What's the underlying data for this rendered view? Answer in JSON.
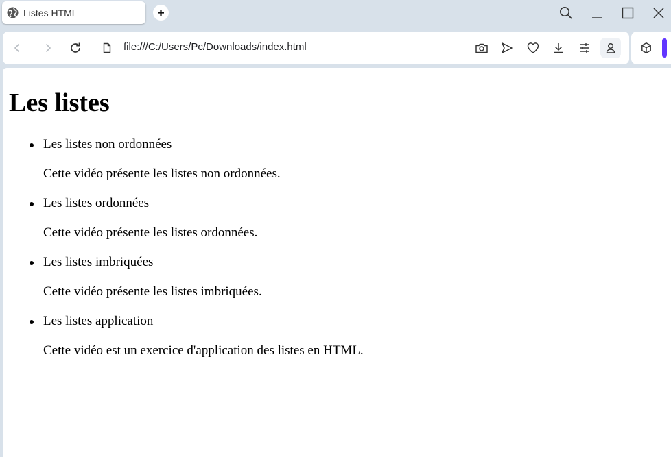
{
  "tab": {
    "title": "Listes HTML"
  },
  "address_bar": {
    "url": "file:///C:/Users/Pc/Downloads/index.html"
  },
  "colors": {
    "accent": "#6236ff",
    "chrome_bg": "#d8e1ea"
  },
  "page": {
    "heading": "Les listes",
    "items": [
      {
        "title": "Les listes non ordonnées",
        "description": "Cette vidéo présente les listes non ordonnées."
      },
      {
        "title": "Les listes ordonnées",
        "description": "Cette vidéo présente les listes ordonnées."
      },
      {
        "title": "Les listes imbriquées",
        "description": "Cette vidéo présente les listes imbriquées."
      },
      {
        "title": "Les listes application",
        "description": "Cette vidéo est un exercice d'application des listes en HTML."
      }
    ]
  }
}
